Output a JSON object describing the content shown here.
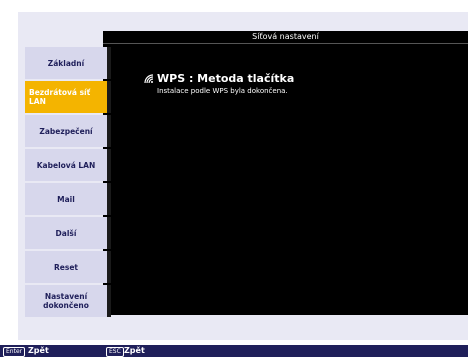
{
  "window_title": "Síťová nastavení",
  "sidebar": {
    "items": [
      {
        "label": "Základní"
      },
      {
        "label": "Bezdrátová síť LAN"
      },
      {
        "label": "Zabezpečení"
      },
      {
        "label": "Kabelová LAN"
      },
      {
        "label": "Mail"
      },
      {
        "label": "Další"
      },
      {
        "label": "Reset"
      },
      {
        "label": "Nastavení dokončeno"
      }
    ]
  },
  "main": {
    "heading": "WPS : Metoda tlačítka",
    "message": "Instalace podle WPS byla dokončena."
  },
  "footer": {
    "enter_key": "Enter",
    "enter_label": "Zpět",
    "esc_key": "ESC",
    "esc_label": "Zpět"
  },
  "colors": {
    "accent_active": "#f4b400",
    "sidebar_bg": "#d7d7ec",
    "footer_bg": "#1f1f5a"
  },
  "icons": {
    "wps": "wifi-icon"
  }
}
